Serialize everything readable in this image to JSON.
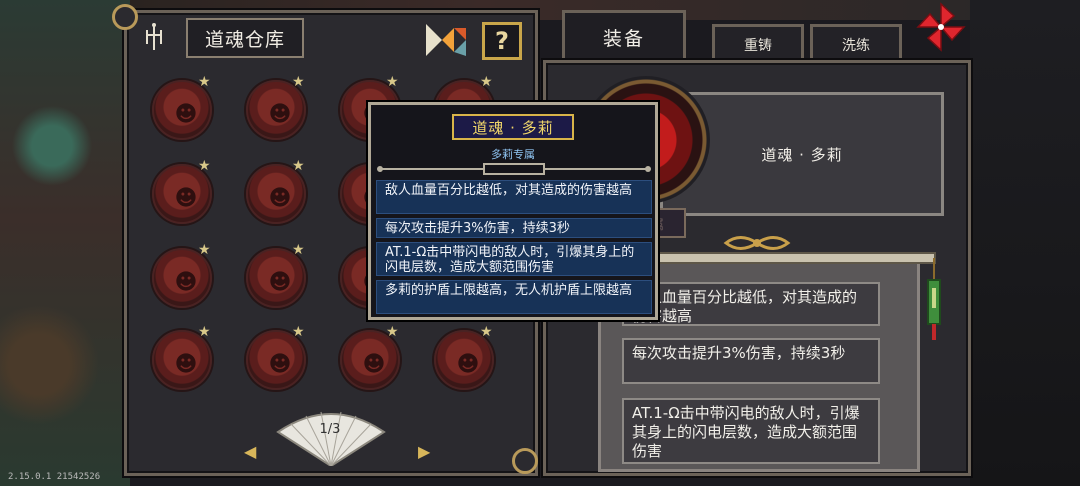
{
  "version": "2.15.0.1 21542526",
  "warehouse": {
    "title": "道魂仓库",
    "help_label": "?",
    "page_indicator": "1/3",
    "prev_label": "◀",
    "next_label": "▶",
    "souls": [
      {
        "face": "☻",
        "star": "★"
      },
      {
        "face": "☻",
        "star": "★"
      },
      {
        "face": "☻",
        "star": "★"
      },
      {
        "face": "☻",
        "star": "★"
      },
      {
        "face": "☻",
        "star": "★"
      },
      {
        "face": "☻",
        "star": "★"
      },
      {
        "face": "☻",
        "star": "★"
      },
      {
        "face": "☻",
        "star": "★"
      },
      {
        "face": "☻",
        "star": "★"
      },
      {
        "face": "☻",
        "star": "★"
      },
      {
        "face": "☻",
        "star": "★"
      },
      {
        "face": "☻",
        "star": "★"
      },
      {
        "face": "☻",
        "star": "★"
      },
      {
        "face": "☻",
        "star": "★"
      },
      {
        "face": "☻",
        "star": "★"
      },
      {
        "face": "☻",
        "star": "★"
      }
    ]
  },
  "tabs": {
    "equip": "装备",
    "recast": "重铸",
    "refine": "洗练"
  },
  "equip_panel": {
    "name": "道魂 · 多莉",
    "tag": "多莉专属",
    "effects": [
      "敌人血量百分比越低，对其造成的伤害越高",
      "每次攻击提升3%伤害，持续3秒",
      "AT.1-Ω击中带闪电的敌人时，引爆其身上的闪电层数，造成大额范围伤害"
    ]
  },
  "tooltip": {
    "title": "道魂 · 多莉",
    "subtitle": "多莉专属",
    "lines": [
      "敌人血量百分比越低，对其造成的伤害越高",
      "每次攻击提升3%伤害，持续3秒",
      "AT.1-Ω击中带闪电的敌人时，引爆其身上的闪电层数，造成大额范围伤害",
      "多莉的护盾上限越高，无人机护盾上限越高"
    ]
  },
  "colors": {
    "panel_border": "#6b6258",
    "gold_accent": "#d8b449",
    "tooltip_line_bg": "#173257",
    "soul_red": "#7a2a25"
  },
  "icons": {
    "fork": "fork-icon",
    "tangram": "tangram-icon",
    "close": "pinwheel-close-icon",
    "star": "star-icon"
  }
}
